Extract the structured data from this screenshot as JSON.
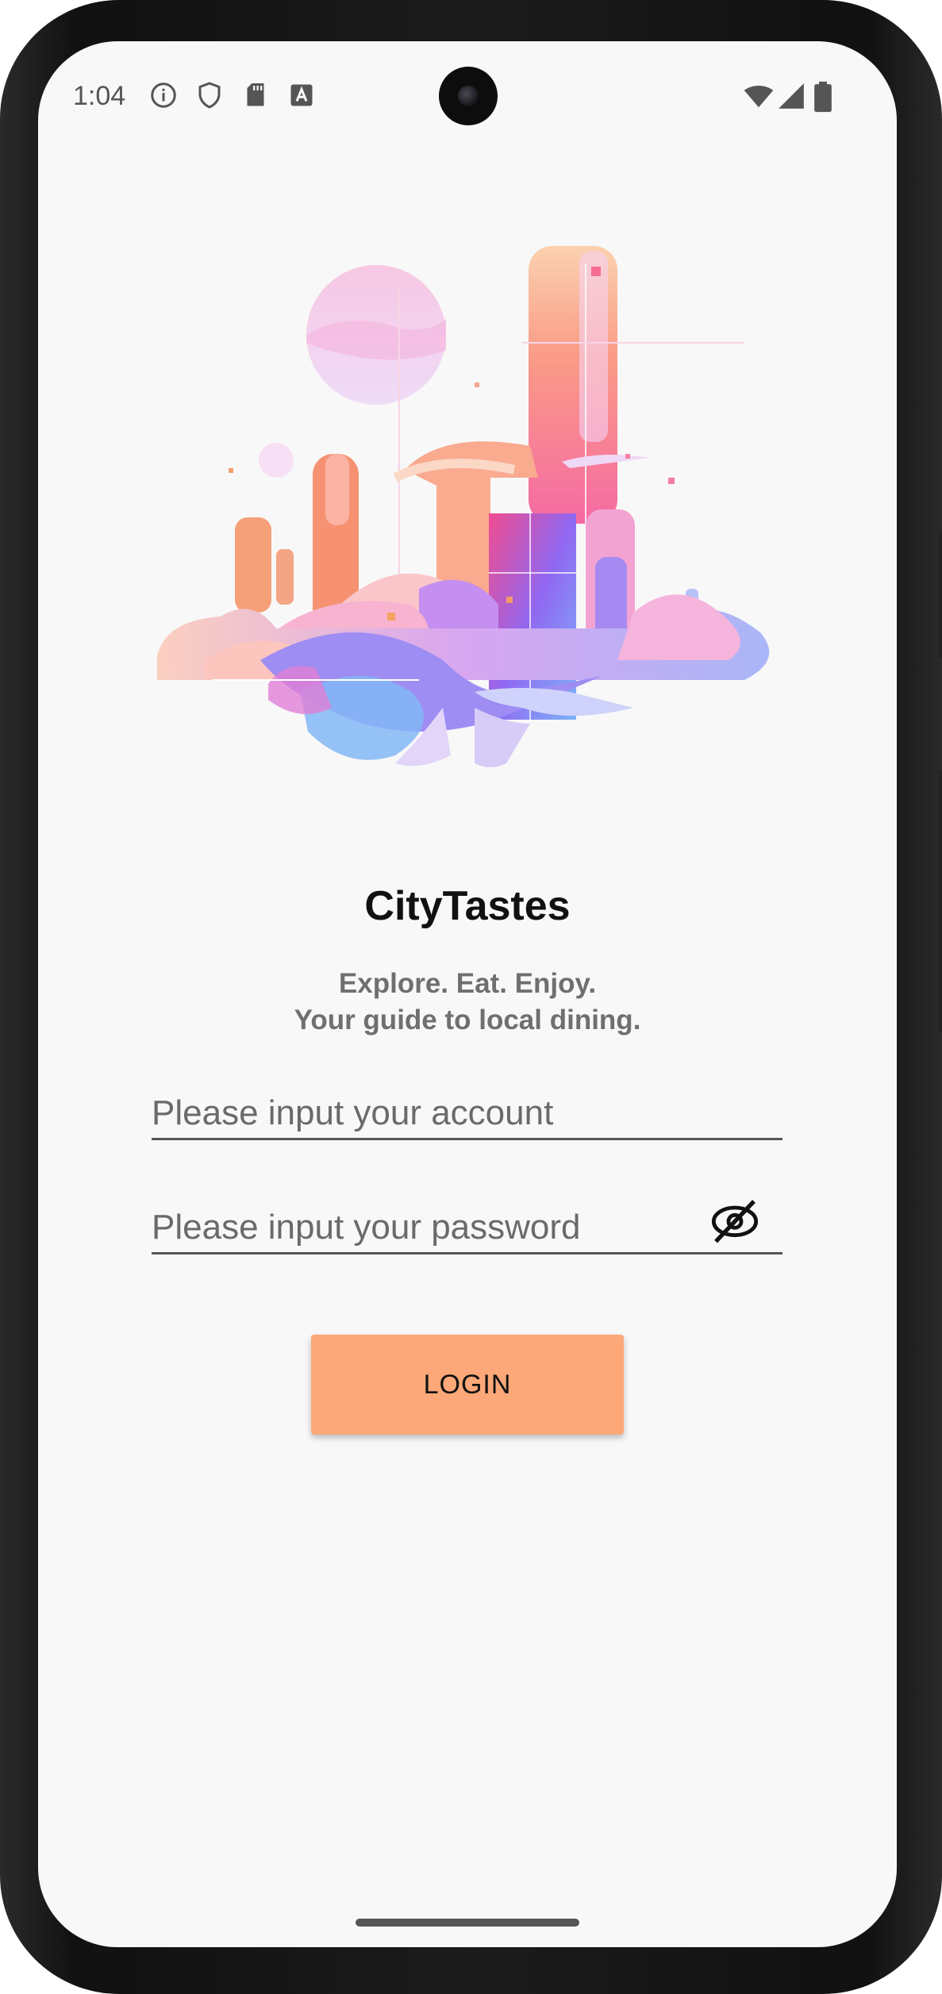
{
  "status_bar": {
    "time": "1:04",
    "left_icons": [
      "info-icon",
      "shield-icon",
      "sd-card-icon",
      "keyboard-a-icon"
    ],
    "right_icons": [
      "wifi-icon",
      "signal-icon",
      "battery-icon"
    ]
  },
  "app": {
    "title": "CityTastes",
    "tagline_line1": "Explore. Eat. Enjoy.",
    "tagline_line2": "Your guide to local dining."
  },
  "form": {
    "account_placeholder": "Please input your account",
    "account_value": "",
    "password_placeholder": "Please input your password",
    "password_value": "",
    "password_visibility_icon": "eye-off-icon",
    "login_label": "LOGIN"
  },
  "colors": {
    "accent": "#fda878",
    "background": "#f8f8f8",
    "text_secondary": "#6f6f6f"
  }
}
